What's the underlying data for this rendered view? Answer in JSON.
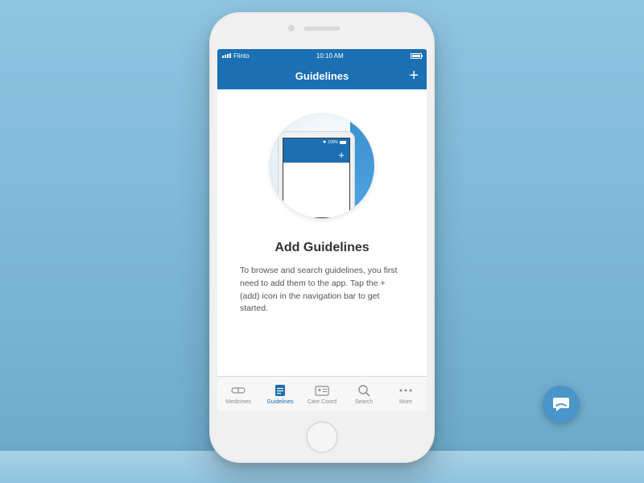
{
  "status_bar": {
    "carrier": "Flinto",
    "time": "10:10 AM",
    "battery_pct": "100%"
  },
  "nav": {
    "title": "Guidelines",
    "add_label": "+"
  },
  "illustration": {
    "battery_text": "100%",
    "plus": "+"
  },
  "empty_state": {
    "heading": "Add Guidelines",
    "body": "To browse and search guidelines, you first need to add them to the app. Tap the + (add) icon in the navigation bar to get started."
  },
  "tabs": [
    {
      "label": "Medicines",
      "icon": "pill"
    },
    {
      "label": "Guidelines",
      "icon": "clipboard"
    },
    {
      "label": "Care Coord",
      "icon": "id-card"
    },
    {
      "label": "Search",
      "icon": "magnifier"
    },
    {
      "label": "More",
      "icon": "dots"
    }
  ],
  "active_tab_index": 1
}
